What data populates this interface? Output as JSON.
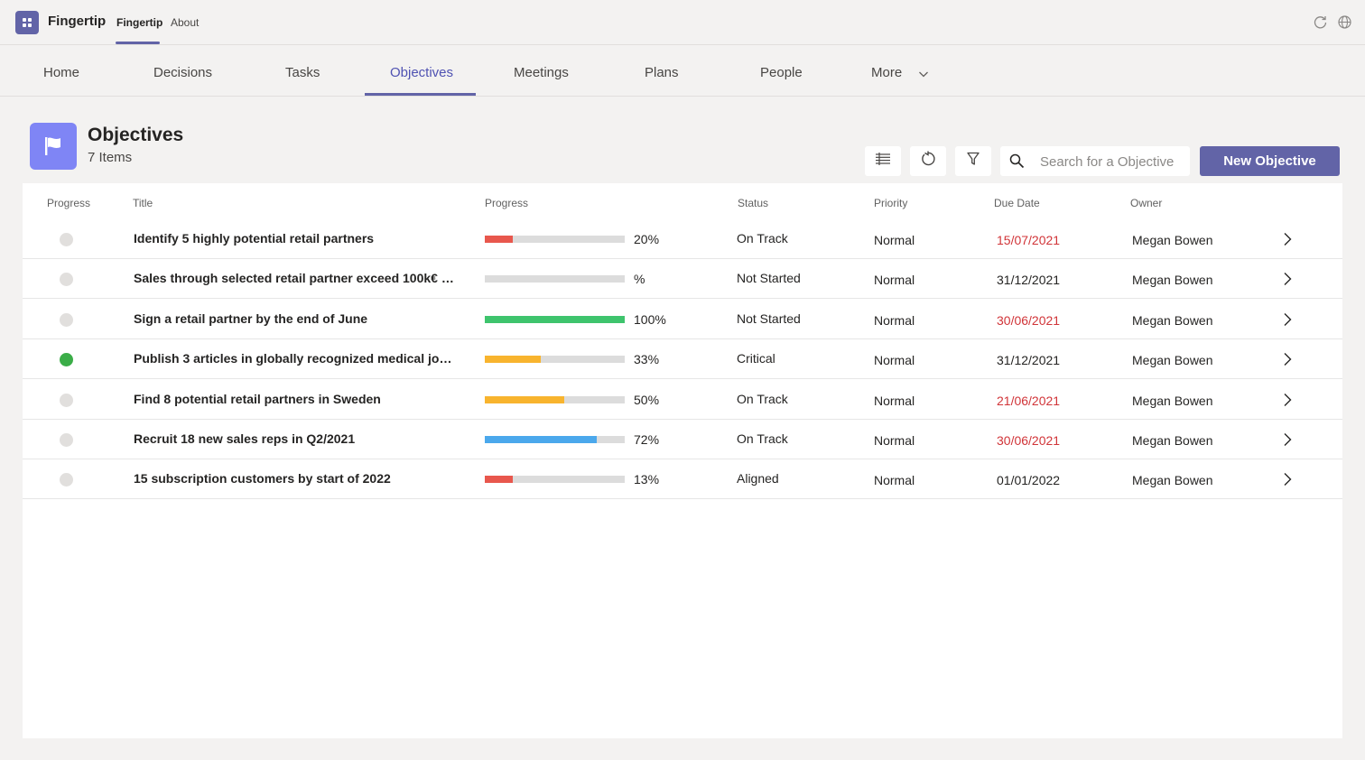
{
  "app": {
    "name": "Fingertip",
    "tabs": [
      {
        "label": "Fingertip",
        "active": true
      },
      {
        "label": "About",
        "active": false
      }
    ],
    "icons": [
      "refresh-icon",
      "globe-icon"
    ]
  },
  "nav": {
    "items": [
      {
        "label": "Home"
      },
      {
        "label": "Decisions"
      },
      {
        "label": "Tasks"
      },
      {
        "label": "Objectives"
      },
      {
        "label": "Meetings"
      },
      {
        "label": "Plans"
      },
      {
        "label": "People"
      },
      {
        "label": "More"
      }
    ],
    "active": "Objectives"
  },
  "header": {
    "title": "Objectives",
    "count": "7 Items",
    "icon": "flag-icon"
  },
  "toolbar": {
    "icons": [
      "list-view-icon",
      "refresh-icon",
      "filter-icon"
    ],
    "search_placeholder": "Search for a Objective",
    "new_label": "New Objective"
  },
  "table": {
    "headers": {
      "progress_dot": "Progress",
      "title": "Title",
      "progress": "Progress",
      "status": "Status",
      "priority": "Priority",
      "due": "Due Date",
      "owner": "Owner"
    },
    "rows": [
      {
        "completed": false,
        "title": "Identify 5 highly potential retail partners",
        "progress": 0.2,
        "progress_text": "20%",
        "bar_color": "#e8574d",
        "status": "On Track",
        "priority": "Normal",
        "due": "15/07/2021",
        "overdue": true,
        "owner": "Megan Bowen"
      },
      {
        "completed": false,
        "title": "Sales through selected retail partner exceed 100k€ by ...",
        "progress": 0,
        "progress_text": "%",
        "bar_color": "#dcdcdc",
        "status": "Not Started",
        "priority": "Normal",
        "due": "31/12/2021",
        "overdue": false,
        "owner": "Megan Bowen"
      },
      {
        "completed": false,
        "title": "Sign a retail partner by the end of June",
        "progress": 1.0,
        "progress_text": "100%",
        "bar_color": "#3ec46d",
        "status": "Not Started",
        "priority": "Normal",
        "due": "30/06/2021",
        "overdue": true,
        "owner": "Megan Bowen"
      },
      {
        "completed": true,
        "title": "Publish 3 articles in globally recognized medical journ...",
        "progress": 0.4,
        "progress_text": "33%",
        "bar_color": "#f8b42e",
        "status": "Critical",
        "priority": "Normal",
        "due": "31/12/2021",
        "overdue": false,
        "owner": "Megan Bowen"
      },
      {
        "completed": false,
        "title": "Find 8 potential retail partners in Sweden",
        "progress": 0.57,
        "progress_text": "50%",
        "bar_color": "#f8b42e",
        "status": "On Track",
        "priority": "Normal",
        "due": "21/06/2021",
        "overdue": true,
        "owner": "Megan Bowen"
      },
      {
        "completed": false,
        "title": "Recruit 18 new sales reps in Q2/2021",
        "progress": 0.8,
        "progress_text": "72%",
        "bar_color": "#4ba8ec",
        "status": "On Track",
        "priority": "Normal",
        "due": "30/06/2021",
        "overdue": true,
        "owner": "Megan Bowen"
      },
      {
        "completed": false,
        "title": "15 subscription customers by start of 2022",
        "progress": 0.2,
        "progress_text": "13%",
        "bar_color": "#e8574d",
        "status": "Aligned",
        "priority": "Normal",
        "due": "01/01/2022",
        "overdue": false,
        "owner": "Megan Bowen"
      }
    ]
  },
  "colors": {
    "accent": "#6264a7",
    "active_tab_text": "#4f52b2",
    "overdue": "#d13438",
    "completed_dot": "#3bad48",
    "pending_dot": "#e1dfdd"
  }
}
